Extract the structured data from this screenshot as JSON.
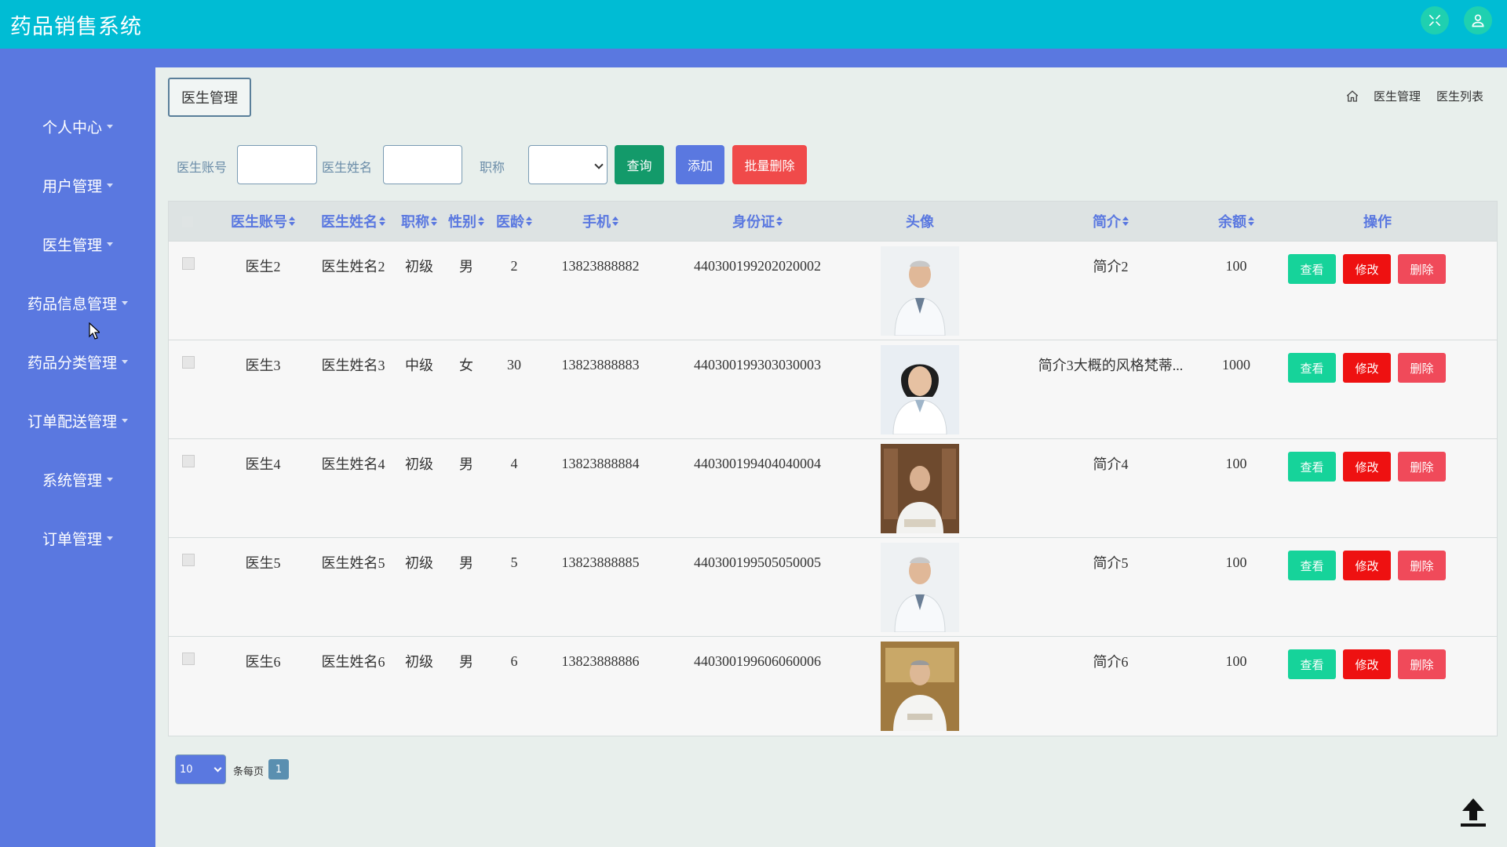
{
  "app": {
    "title": "药品销售系统"
  },
  "header": {
    "icons": [
      "fullscreen-icon",
      "user-icon"
    ]
  },
  "sidebar": {
    "items": [
      {
        "label": "个人中心"
      },
      {
        "label": "用户管理"
      },
      {
        "label": "医生管理"
      },
      {
        "label": "药品信息管理"
      },
      {
        "label": "药品分类管理"
      },
      {
        "label": "订单配送管理"
      },
      {
        "label": "系统管理"
      },
      {
        "label": "订单管理"
      }
    ]
  },
  "page": {
    "tag": "医生管理"
  },
  "breadcrumb": {
    "level1": "医生管理",
    "level2": "医生列表"
  },
  "search": {
    "account_label": "医生账号",
    "account_value": "",
    "name_label": "医生姓名",
    "name_value": "",
    "title_label": "职称",
    "title_value": "",
    "query_label": "查询",
    "add_label": "添加",
    "batch_delete_label": "批量删除"
  },
  "table": {
    "headers": {
      "account": "医生账号",
      "name": "医生姓名",
      "title": "职称",
      "gender": "性别",
      "years": "医龄",
      "phone": "手机",
      "idcard": "身份证",
      "avatar": "头像",
      "intro": "简介",
      "balance": "余额",
      "actions": "操作"
    },
    "rows": [
      {
        "account": "医生2",
        "name": "医生姓名2",
        "title": "初级",
        "gender": "男",
        "years": "2",
        "phone": "13823888882",
        "idcard": "440300199202020002",
        "intro": "简介2",
        "balance": "100"
      },
      {
        "account": "医生3",
        "name": "医生姓名3",
        "title": "中级",
        "gender": "女",
        "years": "30",
        "phone": "13823888883",
        "idcard": "440300199303030003",
        "intro": "简介3大概的风格梵蒂...",
        "balance": "1000"
      },
      {
        "account": "医生4",
        "name": "医生姓名4",
        "title": "初级",
        "gender": "男",
        "years": "4",
        "phone": "13823888884",
        "idcard": "440300199404040004",
        "intro": "简介4",
        "balance": "100"
      },
      {
        "account": "医生5",
        "name": "医生姓名5",
        "title": "初级",
        "gender": "男",
        "years": "5",
        "phone": "13823888885",
        "idcard": "440300199505050005",
        "intro": "简介5",
        "balance": "100"
      },
      {
        "account": "医生6",
        "name": "医生姓名6",
        "title": "初级",
        "gender": "男",
        "years": "6",
        "phone": "13823888886",
        "idcard": "440300199606060006",
        "intro": "简介6",
        "balance": "100"
      }
    ],
    "actions": {
      "view": "查看",
      "edit": "修改",
      "delete": "删除"
    }
  },
  "pagination": {
    "page_size": "10",
    "per_page_label": "条每页",
    "current_page": "1"
  },
  "colors": {
    "topbar": "#00bcd4",
    "sidebar": "#5a78e0",
    "query": "#139a6a",
    "delete": "#f04a5a",
    "edit": "#ee1111",
    "view": "#16d39a"
  }
}
